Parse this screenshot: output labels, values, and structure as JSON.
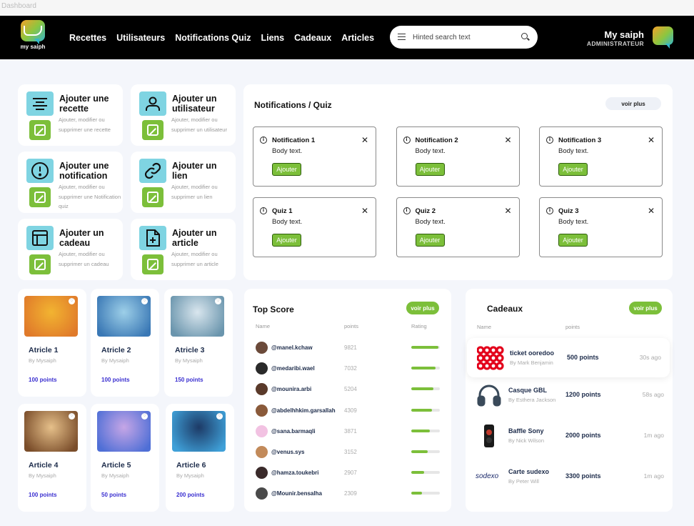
{
  "window": {
    "title": "Dashboard"
  },
  "brand": {
    "logo_text": "my saiph"
  },
  "nav": [
    "Recettes",
    "Utilisateurs",
    "Notifications Quiz",
    "Liens",
    "Cadeaux",
    "Articles"
  ],
  "search": {
    "placeholder": "Hinted search text"
  },
  "user": {
    "name": "My saiph",
    "role": "ADMINISTRATEUR"
  },
  "actions": [
    {
      "title": "Ajouter une recette",
      "desc": "Ajouter, modifier ou supprimer une recette",
      "icon": "list-icon"
    },
    {
      "title": "Ajouter un utilisateur",
      "desc": "Ajouter, modifier ou supprimer un utilisateur",
      "icon": "user-icon"
    },
    {
      "title": "Ajouter une notification",
      "desc": "Ajouter, modifier ou supprimer une Notification quiz",
      "icon": "alert-icon"
    },
    {
      "title": "Ajouter un lien",
      "desc": "Ajouter, modifier ou supprimer un lien",
      "icon": "link-icon"
    },
    {
      "title": "Ajouter un cadeau",
      "desc": "Ajouter, modifier ou supprimer un cadeau",
      "icon": "gift-icon"
    },
    {
      "title": "Ajouter un article",
      "desc": "Ajouter, modifier ou supprimer un article",
      "icon": "file-plus-icon"
    }
  ],
  "notifications": {
    "title": "Notifications / Quiz",
    "more": "voir plus",
    "items": [
      {
        "title": "Notification 1",
        "body": "Body text.",
        "button": "Ajouter"
      },
      {
        "title": "Notification 2",
        "body": "Body text.",
        "button": "Ajouter"
      },
      {
        "title": "Notification 3",
        "body": "Body text.",
        "button": "Ajouter"
      },
      {
        "title": "Quiz 1",
        "body": "Body text.",
        "button": "Ajouter"
      },
      {
        "title": "Quiz 2",
        "body": "Body text.",
        "button": "Ajouter"
      },
      {
        "title": "Quiz 3",
        "body": "Body text.",
        "button": "Ajouter"
      }
    ]
  },
  "articles": [
    {
      "title": "Atricle 1",
      "by": "By Mysaiph",
      "points": "100 points",
      "colors": [
        "#f2b431",
        "#e07a2a"
      ]
    },
    {
      "title": "Atricle 2",
      "by": "By Mysaiph",
      "points": "100 points",
      "colors": [
        "#9dcfe8",
        "#3a78b5"
      ]
    },
    {
      "title": "Atricle 3",
      "by": "By Mysaiph",
      "points": "150 points",
      "colors": [
        "#d9e6ee",
        "#6a95ad"
      ]
    },
    {
      "title": "Article 4",
      "by": "By Mysaiph",
      "points": "100 points",
      "colors": [
        "#e6c08a",
        "#7a4d2a"
      ]
    },
    {
      "title": "Article 5",
      "by": "By Mysaiph",
      "points": "50 points",
      "colors": [
        "#c6a6e6",
        "#4f6fd6"
      ]
    },
    {
      "title": "Article 6",
      "by": "By Mysaiph",
      "points": "200 points",
      "colors": [
        "#1d3a66",
        "#3fa0d8"
      ]
    }
  ],
  "top_score": {
    "title": "Top Score",
    "more": "voir plus",
    "columns": [
      "Name",
      "points",
      "Rating"
    ],
    "rows": [
      {
        "user": "@manel.kchaw",
        "points": "9821",
        "rating": 0.95,
        "color": "#6b4a3a"
      },
      {
        "user": "@medaribi.wael",
        "points": "7032",
        "rating": 0.85,
        "color": "#2a2a2a"
      },
      {
        "user": "@mounira.arbi",
        "points": "5204",
        "rating": 0.78,
        "color": "#5a3a2a"
      },
      {
        "user": "@abdelhhkim.garsallah",
        "points": "4309",
        "rating": 0.72,
        "color": "#8a5a3a"
      },
      {
        "user": "@sana.barmaqli",
        "points": "3871",
        "rating": 0.65,
        "color": "#f2c2e2"
      },
      {
        "user": "@venus.sys",
        "points": "3152",
        "rating": 0.58,
        "color": "#c28a5a"
      },
      {
        "user": "@hamza.toukebri",
        "points": "2907",
        "rating": 0.45,
        "color": "#3a2a2a"
      },
      {
        "user": "@Mounir.bensalha",
        "points": "2309",
        "rating": 0.38,
        "color": "#4a4a4a"
      }
    ]
  },
  "cadeaux": {
    "title": "Cadeaux",
    "more": "voir plus",
    "columns": [
      "Name",
      "points"
    ],
    "rows": [
      {
        "name": "ticket ooredoo",
        "by": "By Mark Benjamin",
        "points": "500 points",
        "time": "30s ago",
        "icon": "ooredoo-logo"
      },
      {
        "name": "Casque GBL",
        "by": "By Esthera Jackson",
        "points": "1200 points",
        "time": "58s ago",
        "icon": "headphones-icon"
      },
      {
        "name": "Baffle  Sony",
        "by": "By Nick Wilson",
        "points": "2000 points",
        "time": "1m ago",
        "icon": "speaker-icon"
      },
      {
        "name": "Carte sudexo",
        "by": "By Peter Will",
        "points": "3300 points",
        "time": "1m ago",
        "icon": "sodexo-logo",
        "logo_text": "sodexo"
      }
    ]
  }
}
